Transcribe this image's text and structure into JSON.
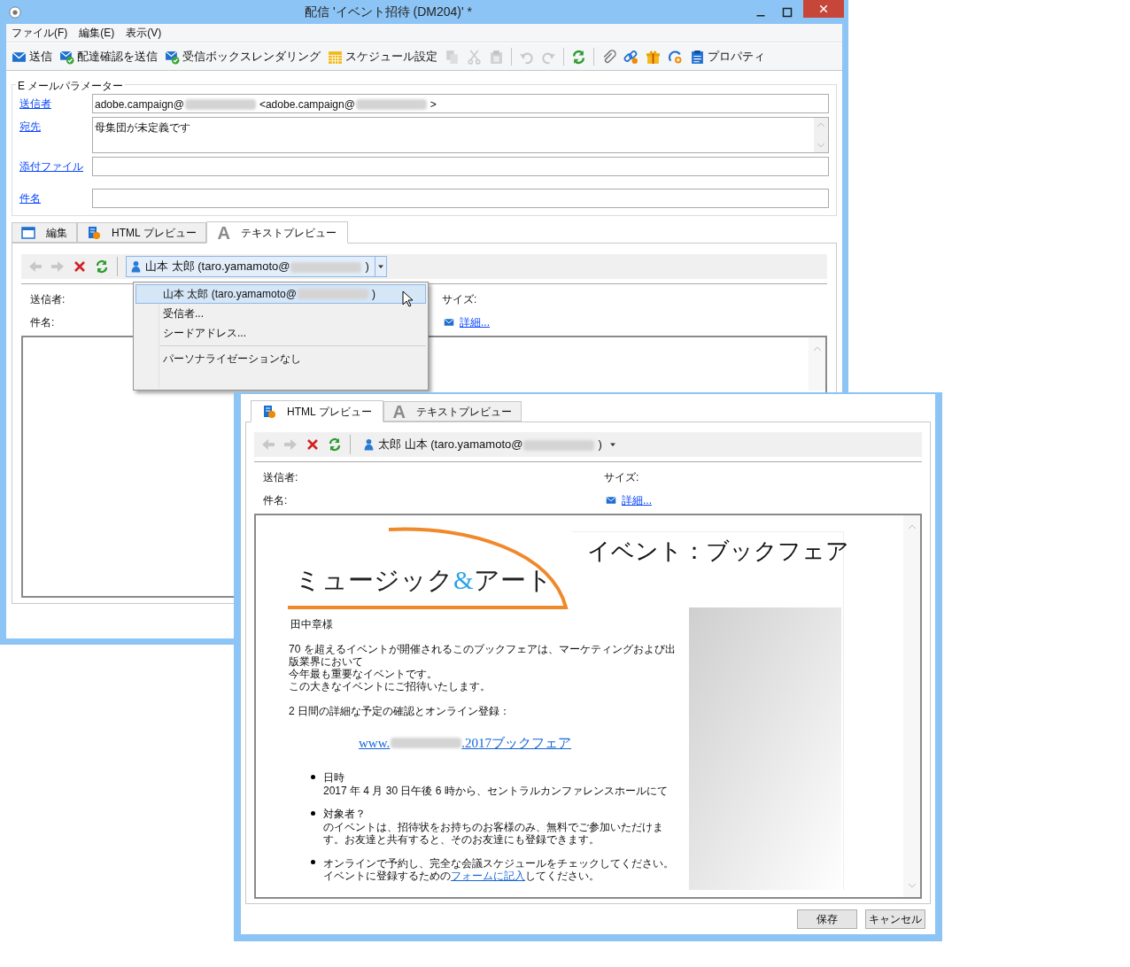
{
  "main_window": {
    "title": "配信 'イベント招待 (DM204)' *",
    "menu": [
      "ファイル(F)",
      "編集(E)",
      "表示(V)"
    ],
    "toolbar": [
      {
        "kind": "send",
        "label": "送信",
        "disabled": false
      },
      {
        "kind": "proof",
        "label": "配達確認を送信",
        "disabled": false
      },
      {
        "kind": "rendering",
        "label": "受信ボックスレンダリング",
        "disabled": false
      },
      {
        "kind": "schedule",
        "label": "スケジュール設定",
        "disabled": false
      },
      {
        "kind": "copy",
        "disabled": true
      },
      {
        "kind": "cut",
        "disabled": true
      },
      {
        "kind": "paste",
        "disabled": true
      },
      {
        "kind": "separator"
      },
      {
        "kind": "undo",
        "disabled": true
      },
      {
        "kind": "redo",
        "disabled": true
      },
      {
        "kind": "separator"
      },
      {
        "kind": "refresh",
        "disabled": false
      },
      {
        "kind": "separator"
      },
      {
        "kind": "attach",
        "disabled": false
      },
      {
        "kind": "link",
        "disabled": false
      },
      {
        "kind": "offer",
        "disabled": false
      },
      {
        "kind": "tracking",
        "disabled": false
      },
      {
        "kind": "properties",
        "label": "プロパティ",
        "disabled": false
      }
    ],
    "email_parameters": {
      "title": "E メールパラメーター",
      "fields": [
        {
          "kind": "line",
          "label": "送信者",
          "value": [
            {
              "kind": "text",
              "text": "adobe.campaign@"
            },
            {
              "kind": "redacted"
            },
            {
              "kind": "text",
              "text": "<adobe.campaign@"
            },
            {
              "kind": "redacted"
            },
            {
              "kind": "text",
              "text": ">"
            }
          ]
        },
        {
          "kind": "multiline",
          "label": "宛先",
          "value": [
            {
              "kind": "text",
              "text": "母集団が未定義です"
            }
          ]
        },
        {
          "kind": "line",
          "label": "添付ファイル"
        },
        {
          "kind": "line",
          "label": "件名"
        }
      ]
    },
    "tabs": [
      {
        "kind": "edit",
        "label": "編集",
        "selected": false
      },
      {
        "kind": "html",
        "label": "HTML プレビュー",
        "selected": false
      },
      {
        "kind": "text",
        "glyph": "A",
        "label": "テキストプレビュー",
        "selected": true
      }
    ],
    "preview_toolbar": {
      "open": true,
      "recipient": [
        {
          "kind": "text",
          "text": "山本 太郎 (taro.yamamoto@"
        },
        {
          "kind": "redacted"
        },
        {
          "kind": "text",
          "text": ")"
        }
      ]
    },
    "headers": {
      "sender_label": "送信者:",
      "subject_label": "件名:",
      "size_label": "サイズ:",
      "details_link": "詳細..."
    }
  },
  "recipient_menu": {
    "items": [
      {
        "kind": "item",
        "selected": true,
        "parts": [
          {
            "kind": "text",
            "text": "山本 太郎 (taro.yamamoto@"
          },
          {
            "kind": "redacted"
          },
          {
            "kind": "text",
            "text": ")"
          }
        ]
      },
      {
        "kind": "item",
        "selected": false,
        "parts": [
          {
            "kind": "text",
            "text": "受信者..."
          }
        ]
      },
      {
        "kind": "item",
        "selected": false,
        "parts": [
          {
            "kind": "text",
            "text": "シードアドレス..."
          }
        ]
      },
      {
        "kind": "separator"
      },
      {
        "kind": "item",
        "selected": false,
        "parts": [
          {
            "kind": "text",
            "text": "パーソナライゼーションなし"
          }
        ]
      }
    ]
  },
  "preview_window": {
    "tabs": [
      {
        "kind": "html",
        "label": "HTML プレビュー",
        "selected": true
      },
      {
        "kind": "text",
        "glyph": "A",
        "label": "テキストプレビュー",
        "selected": false
      }
    ],
    "preview_toolbar": {
      "open": false,
      "recipient": [
        {
          "kind": "text",
          "text": "太郎 山本 (taro.yamamoto@"
        },
        {
          "kind": "redacted"
        },
        {
          "kind": "text",
          "text": ")"
        }
      ]
    },
    "headers": {
      "sender_label": "送信者:",
      "subject_label": "件名:",
      "size_label": "サイズ:",
      "details_link": "詳細..."
    },
    "email": {
      "logo": [
        "ミュージック",
        "&",
        "アート"
      ],
      "heading": "イベント：ブックフェア",
      "greeting": "田中章様",
      "intro": [
        "70 を超えるイベントが開催されるこのブックフェアは、マーケティングおよび出版業界において",
        "今年最も重要なイベントです。",
        "この大きなイベントにご招待いたします。"
      ],
      "schedule_line": "2 日間の詳細な予定の確認とオンライン登録：",
      "link": [
        {
          "kind": "text",
          "text": "www."
        },
        {
          "kind": "redacted"
        },
        {
          "kind": "text",
          "text": ".2017ブックフェア"
        }
      ],
      "bullets": [
        {
          "title": "日時",
          "text": "2017 年 4 月 30 日午後 6 時から、セントラルカンファレンスホールにて"
        },
        {
          "title": "対象者？",
          "text": "のイベントは、招待状をお持ちのお客様のみ、無料でご参加いただけます。お友達と共有すると、そのお友達にも登録できます。"
        },
        {
          "text": "オンラインで予約し、完全な会議スケジュールをチェックしてください。イベントに登録するための",
          "link": "フォームに記入",
          "after": "してください。"
        }
      ]
    },
    "buttons": [
      "保存",
      "キャンセル"
    ]
  }
}
